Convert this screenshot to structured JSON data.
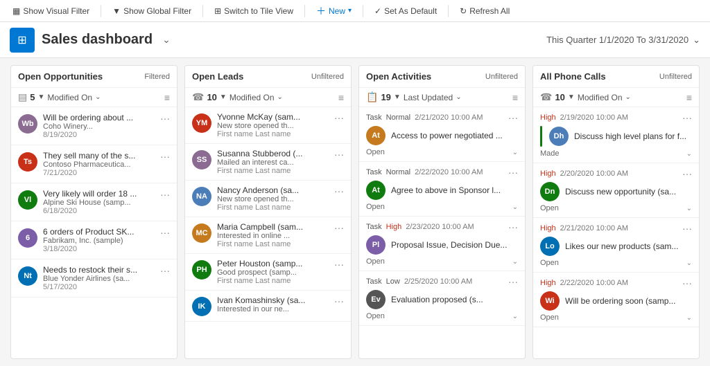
{
  "toolbar": {
    "show_visual_filter": "Show Visual Filter",
    "show_global_filter": "Show Global Filter",
    "switch_to_tile_view": "Switch to Tile View",
    "new_btn": "New",
    "set_as_default": "Set As Default",
    "refresh_all": "Refresh All"
  },
  "dashboard": {
    "title": "Sales dashboard",
    "date_range": "This Quarter 1/1/2020 To 3/31/2020"
  },
  "columns": {
    "open_opportunities": {
      "title": "Open Opportunities",
      "filter_tag": "Filtered",
      "count": 5,
      "sort_label": "Modified On",
      "items": [
        {
          "initials": "Wb",
          "color": "#8b6b91",
          "title": "Will be ordering about ...",
          "company": "Coho Winery...",
          "date": "8/19/2020"
        },
        {
          "initials": "Ts",
          "color": "#c83018",
          "title": "They sell many of the s...",
          "company": "Contoso Pharmaceutica...",
          "date": "7/21/2020"
        },
        {
          "initials": "Vl",
          "color": "#107c10",
          "title": "Very likely will order 18 ...",
          "company": "Alpine Ski House (samp...",
          "date": "6/18/2020"
        },
        {
          "initials": "6",
          "color": "#7b5ea7",
          "title": "6 orders of Product SK...",
          "company": "Fabrikam, Inc. (sample)",
          "date": "3/18/2020"
        },
        {
          "initials": "Nt",
          "color": "#006fb4",
          "title": "Needs to restock their s...",
          "company": "Blue Yonder Airlines (sa...",
          "date": "5/17/2020"
        }
      ]
    },
    "open_leads": {
      "title": "Open Leads",
      "filter_tag": "Unfiltered",
      "count": 10,
      "sort_label": "Modified On",
      "items": [
        {
          "initials": "YM",
          "color": "#c83018",
          "name": "Yvonne McKay (sam...",
          "desc": "New store opened th...",
          "meta": "First name Last name"
        },
        {
          "initials": "SS",
          "color": "#8b6b91",
          "name": "Susanna Stubberod (...",
          "desc": "Mailed an interest ca...",
          "meta": "First name Last name"
        },
        {
          "initials": "NA",
          "color": "#4b7eb9",
          "name": "Nancy Anderson (sa...",
          "desc": "New store opened th...",
          "meta": "First name Last name"
        },
        {
          "initials": "MC",
          "color": "#c67a1e",
          "name": "Maria Campbell (sam...",
          "desc": "Interested in online ...",
          "meta": "First name Last name"
        },
        {
          "initials": "PH",
          "color": "#107c10",
          "name": "Peter Houston (samp...",
          "desc": "Good prospect (samp...",
          "meta": "First name Last name"
        },
        {
          "initials": "IK",
          "color": "#006fb4",
          "name": "Ivan Komashinsky (sa...",
          "desc": "Interested in our ne...",
          "meta": ""
        }
      ]
    },
    "open_activities": {
      "title": "Open Activities",
      "filter_tag": "Unfiltered",
      "count": 19,
      "sort_label": "Last Updated",
      "items": [
        {
          "type": "Task",
          "priority": "Normal",
          "date": "2/21/2020 10:00 AM",
          "avatar_initials": "At",
          "avatar_color": "#c67a1e",
          "title": "Access to power negotiated ...",
          "status": "Open"
        },
        {
          "type": "Task",
          "priority": "Normal",
          "date": "2/22/2020 10:00 AM",
          "avatar_initials": "At",
          "avatar_color": "#107c10",
          "title": "Agree to above in Sponsor l...",
          "status": "Open"
        },
        {
          "type": "Task",
          "priority": "High",
          "date": "2/23/2020 10:00 AM",
          "avatar_initials": "Pl",
          "avatar_color": "#7b5ea7",
          "title": "Proposal Issue, Decision Due...",
          "status": "Open"
        },
        {
          "type": "Task",
          "priority": "Low",
          "date": "2/25/2020 10:00 AM",
          "avatar_initials": "Ev",
          "avatar_color": "#555",
          "title": "Evaluation proposed (s...",
          "status": "Open"
        }
      ]
    },
    "all_phone_calls": {
      "title": "All Phone Calls",
      "filter_tag": "Unfiltered",
      "count": 10,
      "sort_label": "Modified On",
      "items": [
        {
          "priority": "High",
          "date": "2/19/2020 10:00 AM",
          "avatar_initials": "Dh",
          "avatar_color": "#4b7eb9",
          "title": "Discuss high level plans for f...",
          "status": "Made",
          "status_color": "made"
        },
        {
          "priority": "High",
          "date": "2/20/2020 10:00 AM",
          "avatar_initials": "Dn",
          "avatar_color": "#107c10",
          "title": "Discuss new opportunity (sa...",
          "status": "Open",
          "status_color": "open"
        },
        {
          "priority": "High",
          "date": "2/21/2020 10:00 AM",
          "avatar_initials": "Lo",
          "avatar_color": "#006fb4",
          "title": "Likes our new products (sam...",
          "status": "Open",
          "status_color": "open"
        },
        {
          "priority": "High",
          "date": "2/22/2020 10:00 AM",
          "avatar_initials": "Wi",
          "avatar_color": "#c83018",
          "title": "Will be ordering soon (samp...",
          "status": "Open",
          "status_color": "open"
        }
      ]
    }
  }
}
